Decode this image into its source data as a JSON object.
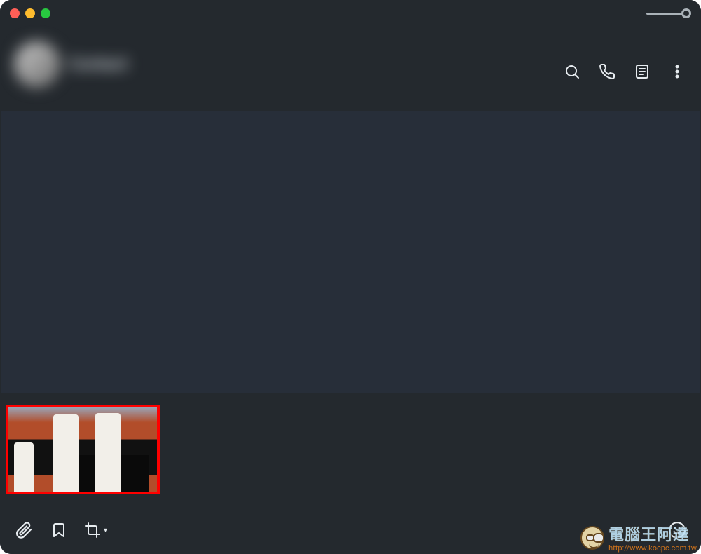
{
  "window": {
    "title": "",
    "traffic_lights": {
      "close": "close",
      "minimize": "minimize",
      "maximize": "maximize"
    }
  },
  "header": {
    "contact_name": "Contact",
    "contact_status": "",
    "actions": {
      "search": "search-icon",
      "call": "phone-icon",
      "details": "details-icon",
      "more": "more-icon"
    }
  },
  "attachments": [
    {
      "name": "image-attachment",
      "selected": true,
      "highlight_color": "#ff0000"
    }
  ],
  "composer": {
    "attach": "paperclip-icon",
    "bookmark": "bookmark-icon",
    "crop": "crop-icon",
    "emoji": "emoji-icon"
  },
  "watermark": {
    "title": "電腦王阿達",
    "url": "http://www.kocpc.com.tw"
  },
  "colors": {
    "header_bg": "#24292e",
    "body_bg": "#272e39",
    "accent_sel": "#ff0000",
    "icon": "#e6ebef"
  }
}
